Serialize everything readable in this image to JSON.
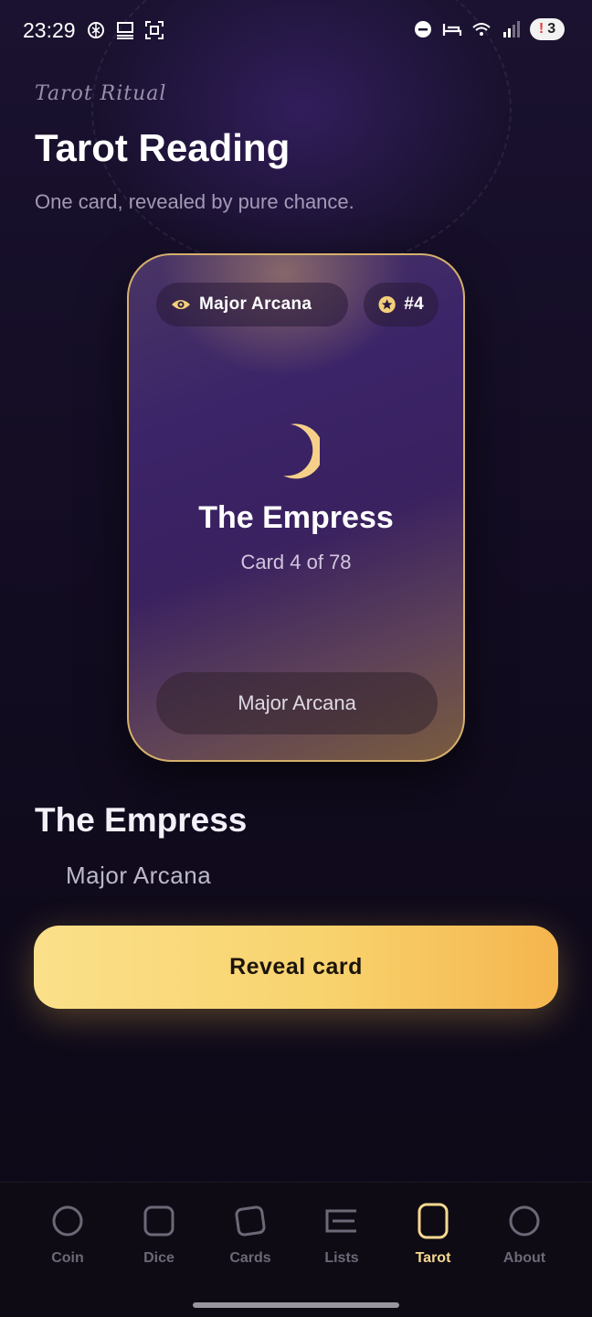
{
  "status_bar": {
    "time": "23:29",
    "notification_count": "3",
    "left_icons": [
      "chatgpt-icon",
      "desktop-icon",
      "screenshot-icon"
    ],
    "right_icons": [
      "do-not-disturb-icon",
      "sleep-icon",
      "wifi-icon",
      "signal-icon"
    ]
  },
  "header": {
    "kicker": "Tarot Ritual",
    "title": "Tarot Reading",
    "subtitle": "One card, revealed by pure chance."
  },
  "card": {
    "arcana_pill": "Major Arcana",
    "number_pill": "#4",
    "name": "The Empress",
    "position": "Card 4 of 78",
    "footer": "Major Arcana",
    "icon": "crescent-moon-icon",
    "border_color": "#d6b06c"
  },
  "result": {
    "name": "The Empress",
    "arcana": "Major Arcana"
  },
  "actions": {
    "reveal_label": "Reveal card"
  },
  "nav": {
    "items": [
      {
        "label": "Coin",
        "icon": "circle-icon",
        "active": false
      },
      {
        "label": "Dice",
        "icon": "square-icon",
        "active": false
      },
      {
        "label": "Cards",
        "icon": "tilted-square-icon",
        "active": false
      },
      {
        "label": "Lists",
        "icon": "list-icon",
        "active": false
      },
      {
        "label": "Tarot",
        "icon": "rounded-rect-icon",
        "active": true
      },
      {
        "label": "About",
        "icon": "circle-icon",
        "active": false
      }
    ],
    "accent_color": "#f8d990"
  }
}
